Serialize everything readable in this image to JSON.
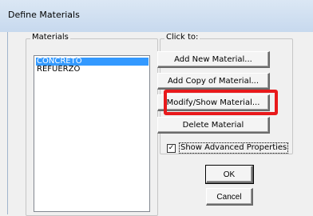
{
  "window": {
    "title": "Define Materials"
  },
  "materials": {
    "label": "Materials",
    "items": [
      {
        "name": "CONCRETO",
        "selected": true
      },
      {
        "name": "REFUERZO",
        "selected": false
      }
    ]
  },
  "actions": {
    "label": "Click to:",
    "add_new": "Add New Material...",
    "add_copy": "Add Copy of Material...",
    "modify_show": "Modify/Show Material...",
    "delete": "Delete Material"
  },
  "advanced": {
    "label": "Show Advanced Properties",
    "checked": true,
    "check_glyph": "✓"
  },
  "buttons": {
    "ok": "OK",
    "cancel": "Cancel"
  },
  "colors": {
    "highlight": "#e8191b",
    "selection": "#3399ff"
  }
}
